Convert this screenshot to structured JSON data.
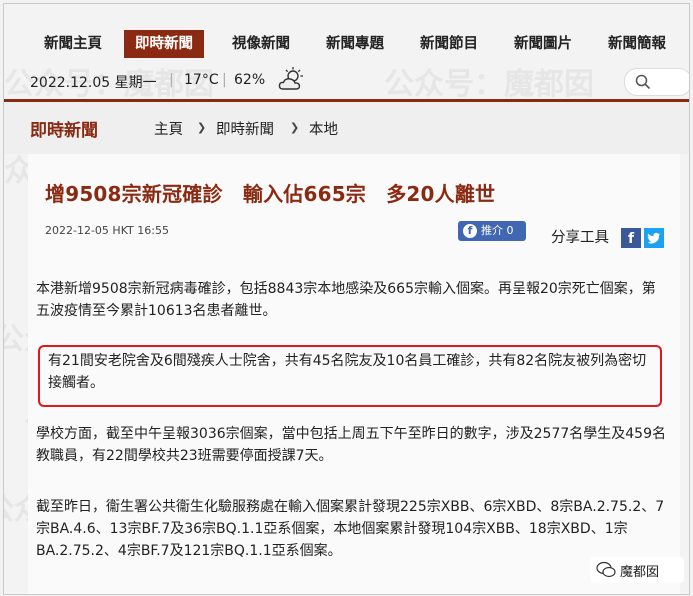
{
  "nav": {
    "items": [
      "新聞主頁",
      "即時新聞",
      "視像新聞",
      "新聞專題",
      "新聞節目",
      "新聞圖片",
      "新聞簡報"
    ],
    "active_index": 1
  },
  "infobar": {
    "date": "2022.12.05 星期一",
    "temperature": "17°C",
    "humidity": "62%",
    "weather_icon": "cloud-sun-icon"
  },
  "breadcrumb": {
    "section_title": "即時新聞",
    "items": [
      "主頁",
      "即時新聞",
      "本地"
    ]
  },
  "article": {
    "headline": "增9508宗新冠確診　輸入佔665宗　多20人離世",
    "timestamp": "2022-12-05 HKT 16:55",
    "like_label": "推介 0",
    "share_label": "分享工具",
    "paragraphs": [
      "本港新增9508宗新冠病毒確診，包括8843宗本地感染及665宗輸入個案。再呈報20宗死亡個案，第五波疫情至今累計10613名患者離世。",
      "有21間安老院舍及6間殘疾人士院舍，共有45名院友及10名員工確診，共有82名院友被列為密切接觸者。",
      "學校方面，截至中午呈報3036宗個案，當中包括上周五下午至昨日的數字，涉及2577名學生及459名教職員，有22間學校共23班需要停面授課7天。",
      "截至昨日，衞生署公共衞生化驗服務處在輸入個案累計發現225宗XBB、6宗XBD、8宗BA.2.75.2、7宗BA.4.6、13宗BF.7及36宗BQ.1.1亞系個案，本地個案累計發現104宗XBB、18宗XBD、1宗BA.2.75.2、4宗BF.7及121宗BQ.1.1亞系個案。"
    ]
  },
  "watermark": "公众号：魔都囡",
  "badge": "魔都囡",
  "colors": {
    "brand": "#8b2a12",
    "highlight": "#e0171b",
    "facebook": "#3b5998",
    "twitter": "#1da1f2"
  }
}
